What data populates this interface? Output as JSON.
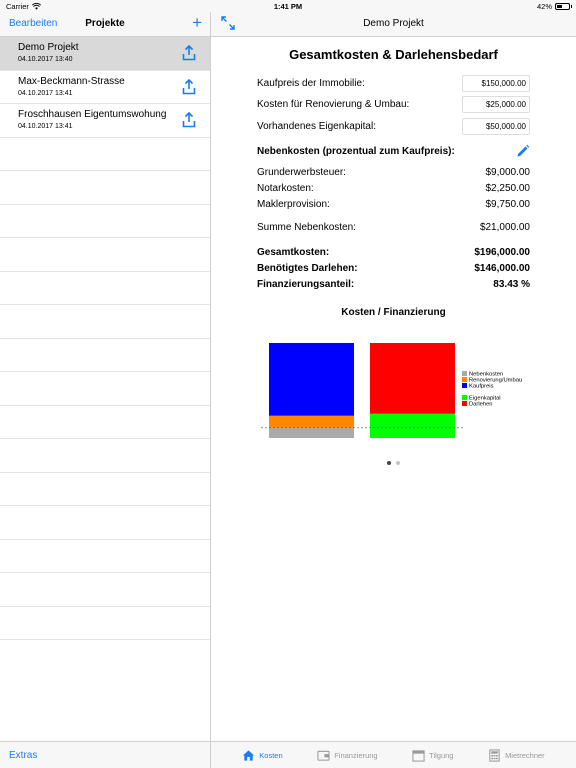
{
  "status": {
    "carrier": "Carrier",
    "time": "1:41 PM",
    "battery": "42%"
  },
  "left": {
    "edit_label": "Bearbeiten",
    "title": "Projekte",
    "add_icon": "plus-icon",
    "projects": [
      {
        "name": "Demo Projekt",
        "date": "04.10.2017 13:40",
        "selected": true
      },
      {
        "name": "Max-Beckmann-Strasse",
        "date": "04.10.2017 13:41",
        "selected": false
      },
      {
        "name": "Froschhausen Eigentumswohung",
        "date": "04.10.2017 13:41",
        "selected": false
      }
    ],
    "extras_label": "Extras"
  },
  "right": {
    "title": "Demo Projekt",
    "heading": "Gesamtkosten & Darlehensbedarf",
    "inputs": {
      "kaufpreis_label": "Kaufpreis der Immobilie:",
      "kaufpreis_value": "$150,000.00",
      "renovierung_label": "Kosten für Renovierung & Umbau:",
      "renovierung_value": "$25,000.00",
      "eigenkapital_label": "Vorhandenes Eigenkapital:",
      "eigenkapital_value": "$50,000.00"
    },
    "nebenkosten": {
      "heading": "Nebenkosten (prozentual zum Kaufpreis):",
      "grunderwerb_label": "Grunderwerbsteuer:",
      "grunderwerb_value": "$9,000.00",
      "notar_label": "Notarkosten:",
      "notar_value": "$2,250.00",
      "makler_label": "Maklerprovision:",
      "makler_value": "$9,750.00",
      "summe_label": "Summe Nebenkosten:",
      "summe_value": "$21,000.00"
    },
    "totals": {
      "gesamt_label": "Gesamtkosten:",
      "gesamt_value": "$196,000.00",
      "darlehen_label": "Benötigtes Darlehen:",
      "darlehen_value": "$146,000.00",
      "anteil_label": "Finanzierungsanteil:",
      "anteil_value": "83.43 %"
    },
    "chart_title": "Kosten / Finanzierung",
    "page_dots": {
      "count": 2,
      "active": 1
    }
  },
  "chart_data": {
    "type": "bar",
    "stacked": true,
    "title": "Kosten / Finanzierung",
    "categories": [
      "Kosten",
      "Finanzierung"
    ],
    "series": [
      {
        "name": "Nebenkosten",
        "color": "#aaaaaa",
        "values": [
          21000,
          0
        ]
      },
      {
        "name": "Renovierung/Umbau",
        "color": "#ff8800",
        "values": [
          25000,
          0
        ]
      },
      {
        "name": "Kaufpreis",
        "color": "#0000ff",
        "values": [
          150000,
          0
        ]
      },
      {
        "name": "Eigenkapital",
        "color": "#00ff00",
        "values": [
          0,
          50000
        ]
      },
      {
        "name": "Darlehen",
        "color": "#ff0000",
        "values": [
          0,
          146000
        ]
      }
    ],
    "legend_groups": [
      [
        "Nebenkosten",
        "Renovierung/Umbau",
        "Kaufpreis"
      ],
      [
        "Eigenkapital",
        "Darlehen"
      ]
    ],
    "legend_position": "right",
    "baseline_dashed": true,
    "ylim": [
      0,
      196000
    ]
  },
  "tabs": [
    {
      "label": "Kosten",
      "icon": "house-icon",
      "active": true
    },
    {
      "label": "Finanzierung",
      "icon": "wallet-icon",
      "active": false
    },
    {
      "label": "Tilgung",
      "icon": "calendar-icon",
      "active": false
    },
    {
      "label": "Mietrechner",
      "icon": "calculator-icon",
      "active": false
    }
  ],
  "colors": {
    "accent": "#1a7cf5",
    "selected_row": "#d9d9d9"
  }
}
